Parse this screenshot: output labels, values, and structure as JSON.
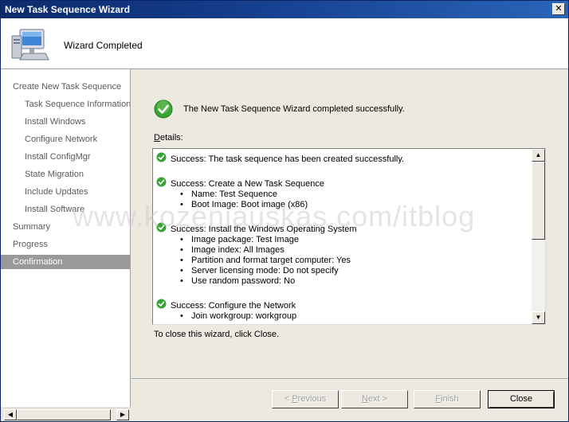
{
  "window": {
    "title": "New Task Sequence Wizard",
    "close_glyph": "✕"
  },
  "header": {
    "icon": "computer-icon",
    "title": "Wizard Completed"
  },
  "sidebar": {
    "items": [
      {
        "label": "Create New Task Sequence",
        "level": 1
      },
      {
        "label": "Task Sequence Information",
        "level": 2
      },
      {
        "label": "Install Windows",
        "level": 2
      },
      {
        "label": "Configure Network",
        "level": 2
      },
      {
        "label": "Install ConfigMgr",
        "level": 2
      },
      {
        "label": "State Migration",
        "level": 2
      },
      {
        "label": "Include Updates",
        "level": 2
      },
      {
        "label": "Install Software",
        "level": 2
      },
      {
        "label": "Summary",
        "level": 1
      },
      {
        "label": "Progress",
        "level": 1
      },
      {
        "label": "Confirmation",
        "level": 1,
        "active": true
      }
    ],
    "scroll_left_glyph": "◀",
    "scroll_right_glyph": "▶"
  },
  "main": {
    "status_icon": "success-check-icon",
    "status_text": "The New Task Sequence Wizard completed successfully.",
    "details_label_u": "D",
    "details_label_rest": "etails:",
    "details": {
      "line1": "Success: The task sequence has been created successfully.",
      "line2": "Success: Create a New Task Sequence",
      "line3": "Name: Test Sequence",
      "line4": "Boot Image: Boot image (x86)",
      "line5": "Success: Install the Windows Operating System",
      "line6": "Image package: Test Image",
      "line7": "Image index: All Images",
      "line8": "Partition and format target computer: Yes",
      "line9": "Server licensing mode: Do not specify",
      "line10": "Use random password: No",
      "line11": "Success: Configure the Network",
      "line12": "Join workgroup: workgroup"
    },
    "scroll_up_glyph": "▲",
    "scroll_down_glyph": "▼",
    "close_hint": "To close this wizard, click Close."
  },
  "buttons": {
    "previous_prefix": "< ",
    "previous_u": "P",
    "previous_rest": "revious",
    "next_u": "N",
    "next_rest": "ext >",
    "finish_u": "F",
    "finish_rest": "inish",
    "close": "Close"
  },
  "watermark": "www.kozeniauskas.com/itblog",
  "colors": {
    "titlebar": "#0c2b6b",
    "active_nav": "#999999",
    "success_green": "#3aa335"
  }
}
